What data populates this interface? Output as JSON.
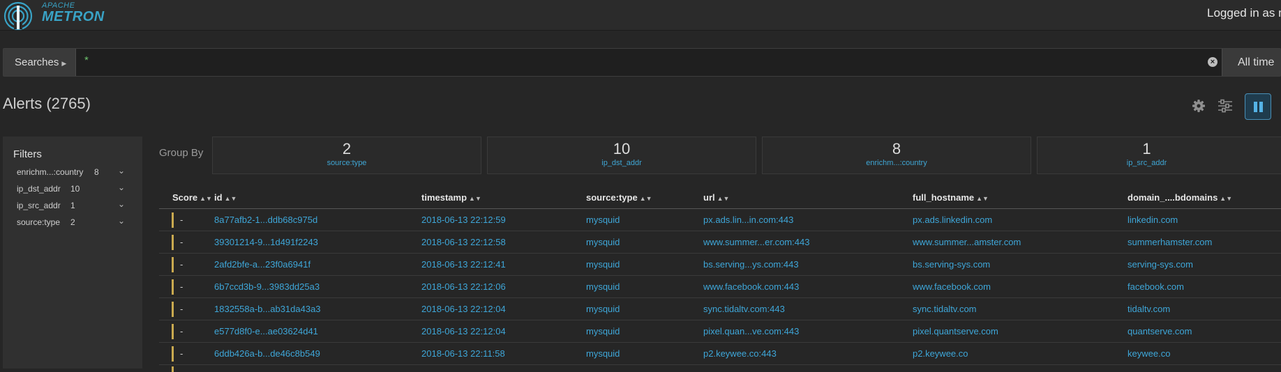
{
  "app": {
    "logo_line1": "APACHE",
    "logo_line2": "METRON",
    "logged_in": "Logged in as m"
  },
  "search": {
    "searches_label": "Searches",
    "query": "*",
    "time_range": "All time"
  },
  "alerts": {
    "title": "Alerts (2765)"
  },
  "filters": {
    "title": "Filters",
    "items": [
      {
        "name": "enrichm...:country",
        "count": "8"
      },
      {
        "name": "ip_dst_addr",
        "count": "10"
      },
      {
        "name": "ip_src_addr",
        "count": "1"
      },
      {
        "name": "source:type",
        "count": "2"
      }
    ]
  },
  "group_by": {
    "label": "Group By",
    "cards": [
      {
        "count": "2",
        "field": "source:type"
      },
      {
        "count": "10",
        "field": "ip_dst_addr"
      },
      {
        "count": "8",
        "field": "enrichm...:country"
      },
      {
        "count": "1",
        "field": "ip_src_addr"
      }
    ]
  },
  "table": {
    "columns": [
      "Score",
      "id",
      "timestamp",
      "source:type",
      "url",
      "full_hostname",
      "domain_....bdomains"
    ],
    "rows": [
      {
        "score": "-",
        "id": "8a77afb2-1...ddb68c975d",
        "timestamp": "2018-06-13 22:12:59",
        "source_type": "mysquid",
        "url": "px.ads.lin...in.com:443",
        "full_hostname": "px.ads.linkedin.com",
        "domain": "linkedin.com"
      },
      {
        "score": "-",
        "id": "39301214-9...1d491f2243",
        "timestamp": "2018-06-13 22:12:58",
        "source_type": "mysquid",
        "url": "www.summer...er.com:443",
        "full_hostname": "www.summer...amster.com",
        "domain": "summerhamster.com"
      },
      {
        "score": "-",
        "id": "2afd2bfe-a...23f0a6941f",
        "timestamp": "2018-06-13 22:12:41",
        "source_type": "mysquid",
        "url": "bs.serving...ys.com:443",
        "full_hostname": "bs.serving-sys.com",
        "domain": "serving-sys.com"
      },
      {
        "score": "-",
        "id": "6b7ccd3b-9...3983dd25a3",
        "timestamp": "2018-06-13 22:12:06",
        "source_type": "mysquid",
        "url": "www.facebook.com:443",
        "full_hostname": "www.facebook.com",
        "domain": "facebook.com"
      },
      {
        "score": "-",
        "id": "1832558a-b...ab31da43a3",
        "timestamp": "2018-06-13 22:12:04",
        "source_type": "mysquid",
        "url": "sync.tidaltv.com:443",
        "full_hostname": "sync.tidaltv.com",
        "domain": "tidaltv.com"
      },
      {
        "score": "-",
        "id": "e577d8f0-e...ae03624d41",
        "timestamp": "2018-06-13 22:12:04",
        "source_type": "mysquid",
        "url": "pixel.quan...ve.com:443",
        "full_hostname": "pixel.quantserve.com",
        "domain": "quantserve.com"
      },
      {
        "score": "-",
        "id": "6ddb426a-b...de46c8b549",
        "timestamp": "2018-06-13 22:11:58",
        "source_type": "mysquid",
        "url": "p2.keywee.co:443",
        "full_hostname": "p2.keywee.co",
        "domain": "keywee.co"
      }
    ]
  }
}
